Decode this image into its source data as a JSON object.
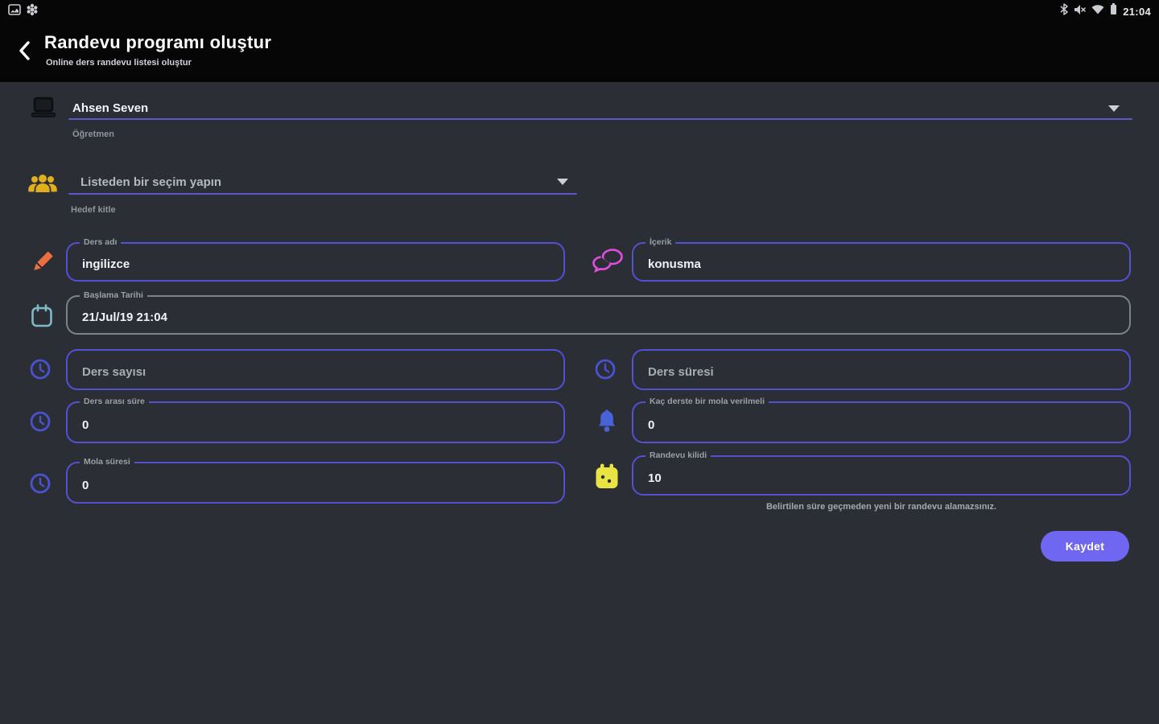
{
  "status_bar": {
    "time": "21:04"
  },
  "header": {
    "title": "Randevu programı oluştur",
    "subtitle": "Online ders randevu listesi oluştur"
  },
  "form": {
    "teacher": {
      "value": "Ahsen Seven",
      "helper": "Öğretmen"
    },
    "audience": {
      "placeholder": "Listeden bir seçim yapın",
      "helper": "Hedef kitle"
    },
    "lesson_name": {
      "label": "Ders adı",
      "value": "ingilizce"
    },
    "content": {
      "label": "İçerik",
      "value": "konusma"
    },
    "start_date": {
      "label": "Başlama Tarihi",
      "value": "21/Jul/19 21:04"
    },
    "lesson_count": {
      "placeholder": "Ders sayısı"
    },
    "lesson_duration": {
      "placeholder": "Ders süresi"
    },
    "lesson_break_gap": {
      "label": "Ders arası süre",
      "value": "0"
    },
    "break_frequency": {
      "label": "Kaç derste bir mola verilmeli",
      "value": "0"
    },
    "break_duration": {
      "label": "Mola süresi",
      "value": "0"
    },
    "appointment_lock": {
      "label": "Randevu kilidi",
      "value": "10",
      "helper": "Belirtilen süre geçmeden yeni bir randevu alamazsınız."
    }
  },
  "actions": {
    "save": "Kaydet"
  },
  "colors": {
    "body_bg": "#2b2e35",
    "bar_bg": "#060607",
    "accent_purple": "#564fd4",
    "button_purple": "#6f67f2",
    "underline_purple": "#5d57c9",
    "date_border_gray": "#7b828c",
    "pencil_orange": "#ee6f3e",
    "chat_pink": "#e04fe0",
    "people_yellow": "#dfaf1e",
    "calendar_teal": "#7fb9c6",
    "clock_blue": "#4a53cf",
    "bell_blue": "#4a62d8",
    "calendar_yellow": "#e9e443"
  }
}
